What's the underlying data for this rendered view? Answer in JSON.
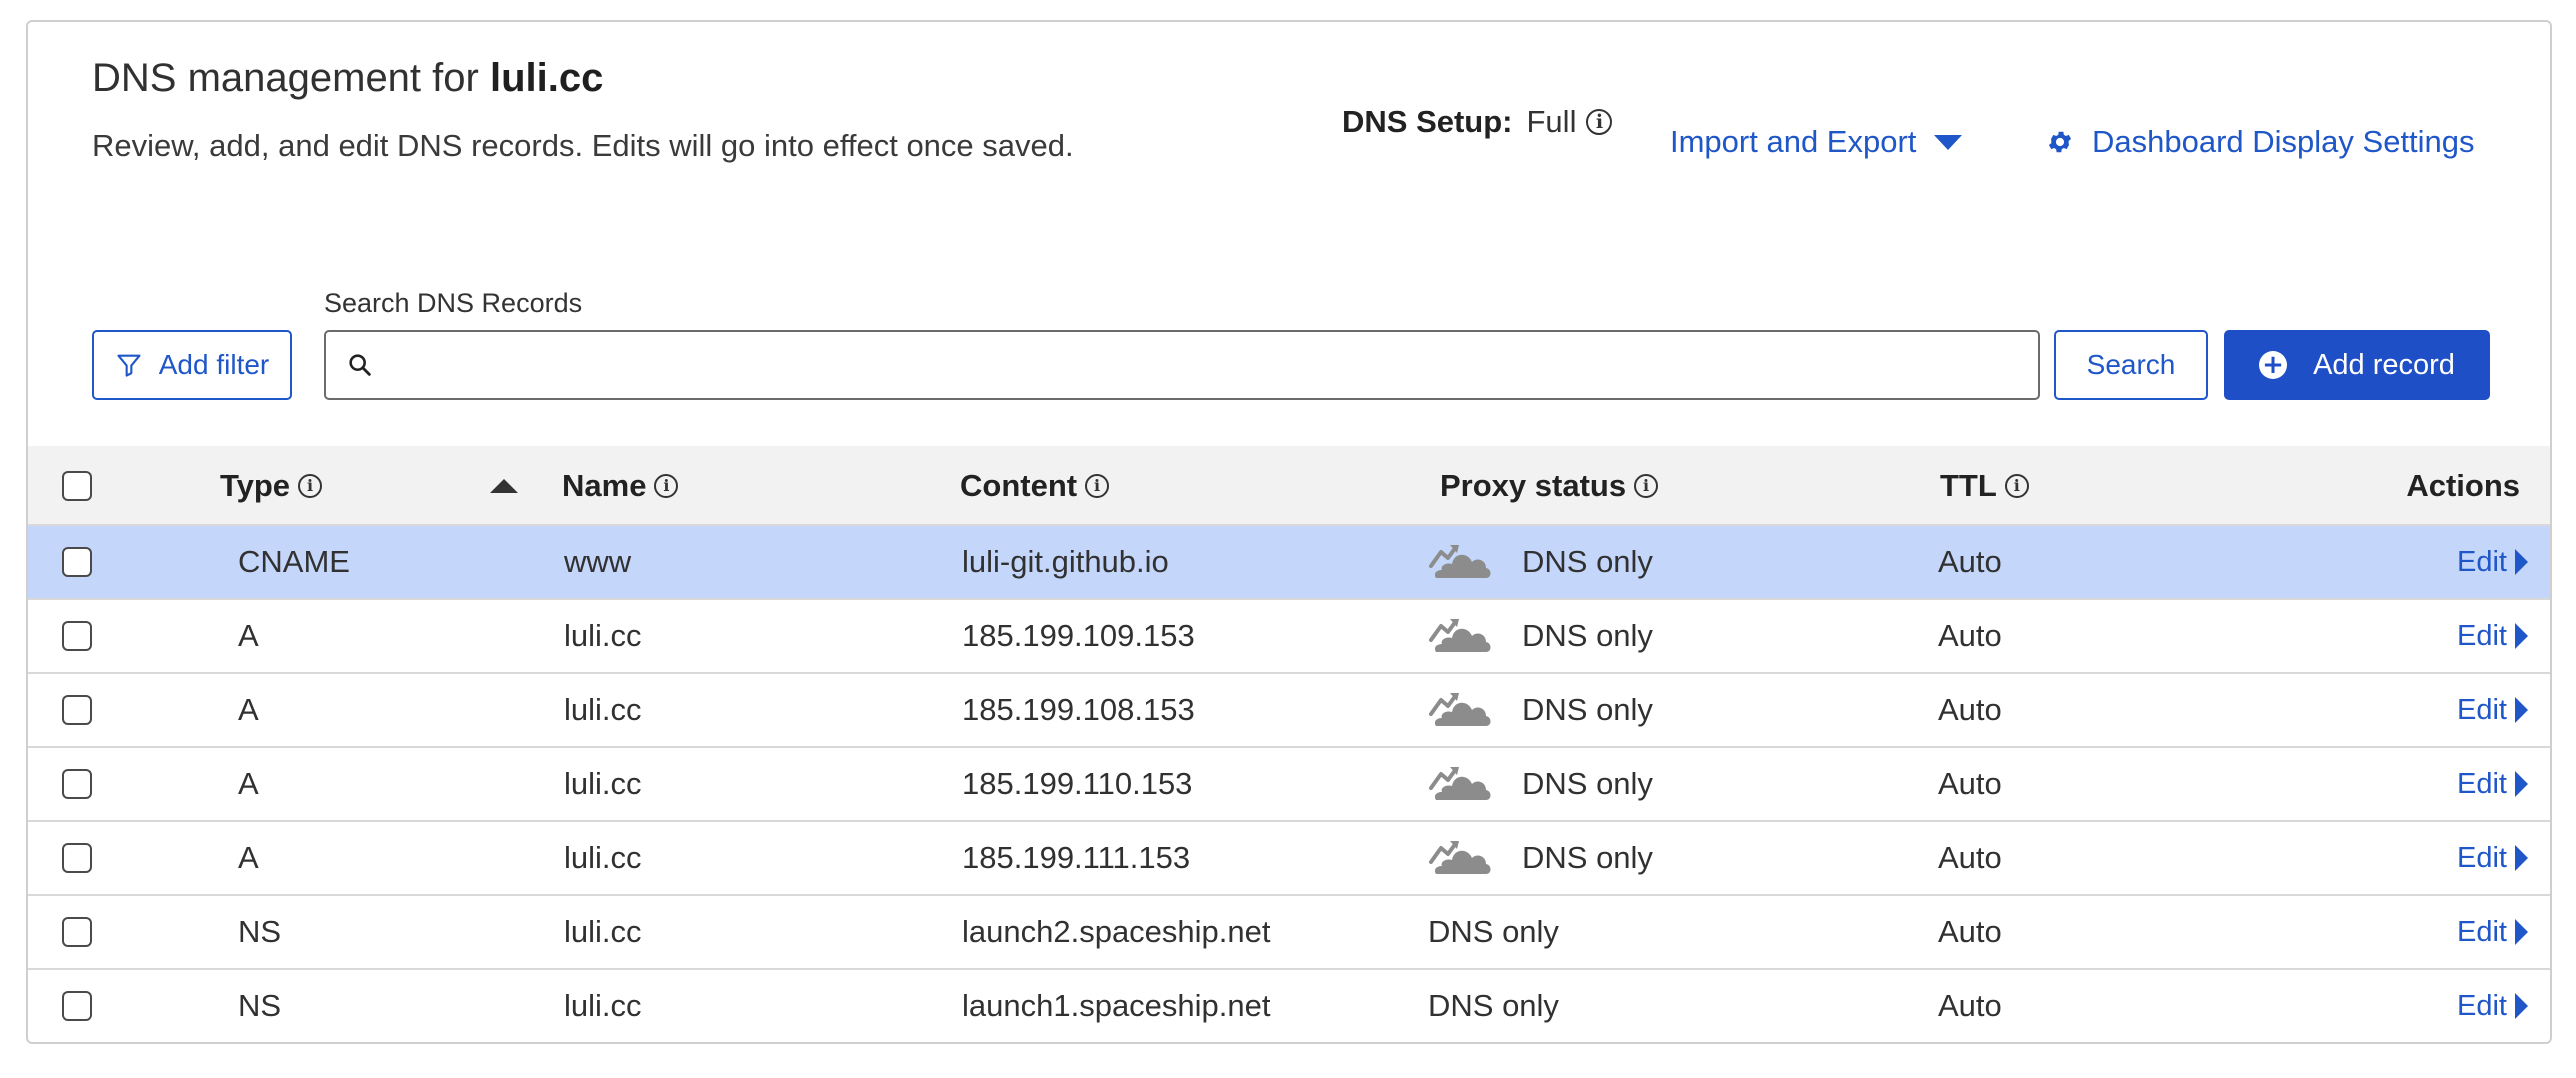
{
  "header": {
    "title_prefix": "DNS management for",
    "domain": "luli.cc",
    "description": "Review, add, and edit DNS records. Edits will go into effect once saved."
  },
  "setup": {
    "label": "DNS Setup:",
    "value": "Full"
  },
  "links": {
    "import_export": "Import and Export",
    "dashboard_settings": "Dashboard Display Settings"
  },
  "toolbar": {
    "add_filter": "Add filter",
    "search_label": "Search DNS Records",
    "search_value": "",
    "search_button": "Search",
    "add_record": "Add record"
  },
  "table": {
    "headers": {
      "type": "Type",
      "name": "Name",
      "content": "Content",
      "proxy": "Proxy status",
      "ttl": "TTL",
      "actions": "Actions"
    },
    "sort": {
      "column": "type",
      "direction": "ascending"
    },
    "edit_label": "Edit",
    "rows": [
      {
        "type": "CNAME",
        "name": "www",
        "content": "luli-git.github.io",
        "proxy": "DNS only",
        "proxy_icon": "dns-only-cloud-icon",
        "ttl": "Auto",
        "selected": true
      },
      {
        "type": "A",
        "name": "luli.cc",
        "content": "185.199.109.153",
        "proxy": "DNS only",
        "proxy_icon": "dns-only-cloud-icon",
        "ttl": "Auto",
        "selected": false
      },
      {
        "type": "A",
        "name": "luli.cc",
        "content": "185.199.108.153",
        "proxy": "DNS only",
        "proxy_icon": "dns-only-cloud-icon",
        "ttl": "Auto",
        "selected": false
      },
      {
        "type": "A",
        "name": "luli.cc",
        "content": "185.199.110.153",
        "proxy": "DNS only",
        "proxy_icon": "dns-only-cloud-icon",
        "ttl": "Auto",
        "selected": false
      },
      {
        "type": "A",
        "name": "luli.cc",
        "content": "185.199.111.153",
        "proxy": "DNS only",
        "proxy_icon": "dns-only-cloud-icon",
        "ttl": "Auto",
        "selected": false
      },
      {
        "type": "NS",
        "name": "luli.cc",
        "content": "launch2.spaceship.net",
        "proxy": "DNS only",
        "proxy_icon": null,
        "ttl": "Auto",
        "selected": false
      },
      {
        "type": "NS",
        "name": "luli.cc",
        "content": "launch1.spaceship.net",
        "proxy": "DNS only",
        "proxy_icon": null,
        "ttl": "Auto",
        "selected": false
      }
    ]
  },
  "colors": {
    "link": "#1f56c8",
    "primary_button": "#1f4fc6",
    "selected_row": "#c5d6fb",
    "header_bg": "#f2f2f2",
    "cloud_icon": "#8c8c8c"
  }
}
